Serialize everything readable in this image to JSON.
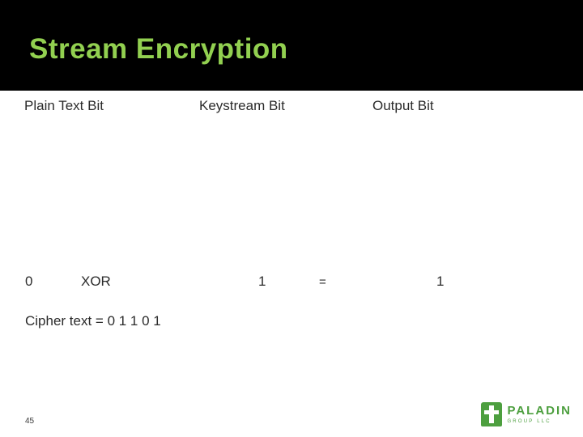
{
  "slide": {
    "title": "Stream Encryption",
    "page_number": "45",
    "colors": {
      "title_band": "#000000",
      "title_text": "#92d050",
      "body_text": "#2b2b2b",
      "logo_green": "#4d9f3f"
    }
  },
  "columns": {
    "plain_text_bit": "Plain Text Bit",
    "keystream_bit": "Keystream Bit",
    "output_bit": "Output Bit"
  },
  "row": {
    "plain_value": "0",
    "operator": "XOR",
    "keystream_value": "1",
    "equals": "=",
    "output_value": "1"
  },
  "cipher": {
    "text": "Cipher text = 0 1 1 0 1"
  },
  "logo": {
    "name": "PALADIN",
    "tagline": "GROUP LLC"
  }
}
